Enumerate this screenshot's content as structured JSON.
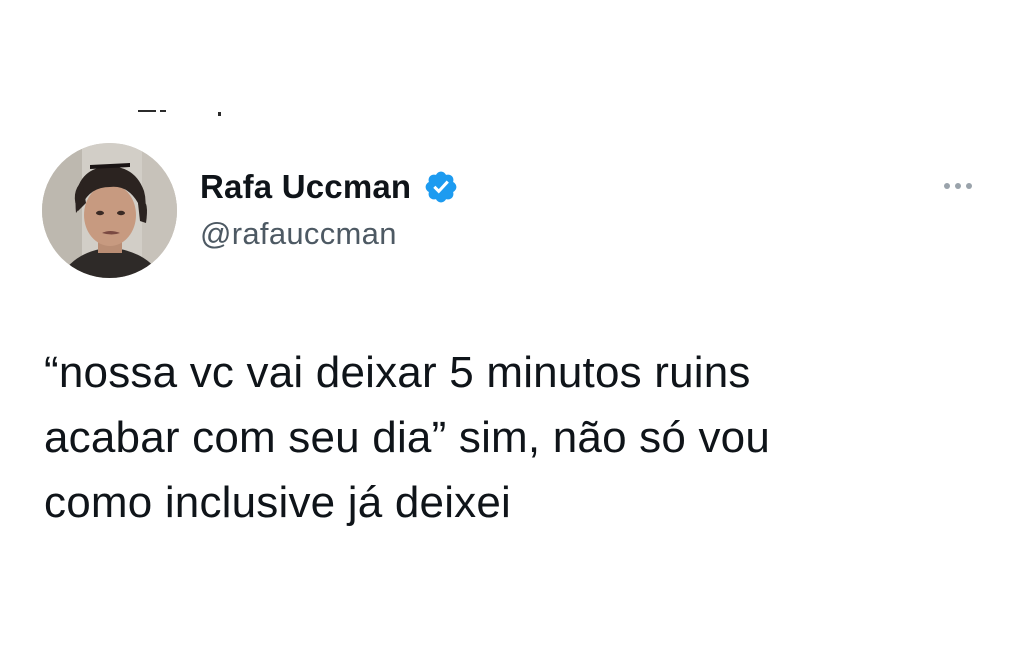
{
  "tweet": {
    "author": {
      "display_name": "Rafa Uccman",
      "handle": "@rafauccman",
      "verified": true,
      "verified_icon": "verified-badge-icon",
      "avatar": "profile-photo"
    },
    "more_icon": "more-dots-icon",
    "text_lines": [
      "“nossa vc vai deixar 5 minutos ruins",
      "acabar com seu dia” sim, não só vou",
      "como inclusive já deixei"
    ]
  },
  "colors": {
    "text": "#0f1419",
    "handle": "#4d5963",
    "verified": "#1d9bf0",
    "more_dots": "#9aa3ab",
    "background": "#ffffff"
  }
}
